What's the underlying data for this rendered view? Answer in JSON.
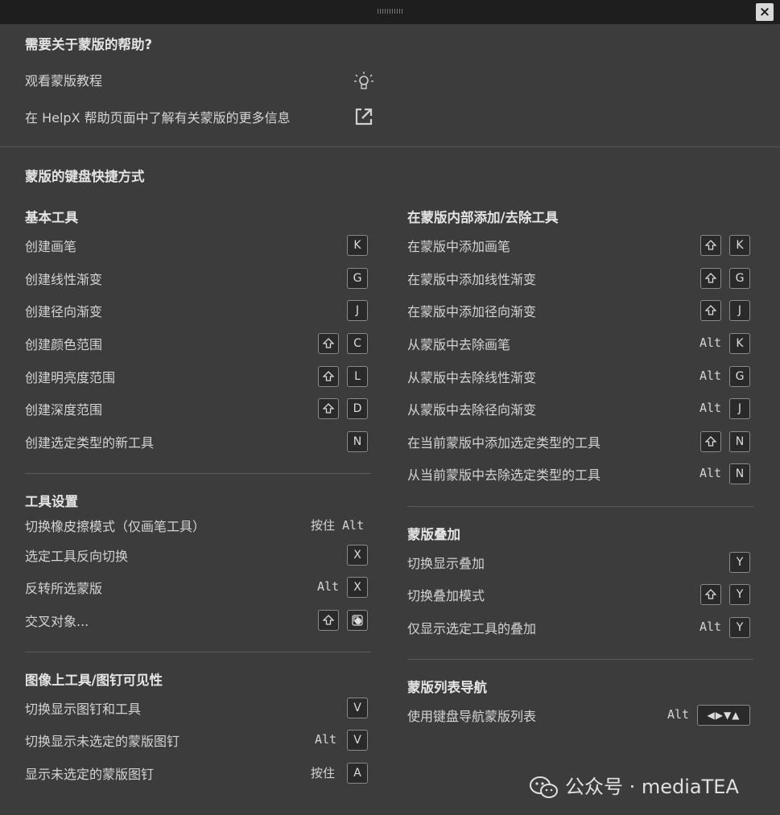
{
  "help": {
    "title": "需要关于蒙版的帮助?",
    "tutorial": "观看蒙版教程",
    "helpx": "在 HelpX 帮助页面中了解有关蒙版的更多信息"
  },
  "shortcuts_title": "蒙版的键盘快捷方式",
  "basic": {
    "title": "基本工具",
    "items": [
      {
        "label": "创建画笔",
        "key": "K"
      },
      {
        "label": "创建线性渐变",
        "key": "G"
      },
      {
        "label": "创建径向渐变",
        "key": "J"
      },
      {
        "label": "创建颜色范围",
        "key": "C"
      },
      {
        "label": "创建明亮度范围",
        "key": "L"
      },
      {
        "label": "创建深度范围",
        "key": "D"
      },
      {
        "label": "创建选定类型的新工具",
        "key": "N"
      }
    ]
  },
  "tool_settings": {
    "title": "工具设置",
    "items": [
      {
        "label": "切换橡皮擦模式（仅画笔工具）",
        "modifier": "按住 Alt"
      },
      {
        "label": "选定工具反向切换",
        "key": "X"
      },
      {
        "label": "反转所选蒙版",
        "modifier": "Alt",
        "key": "X"
      },
      {
        "label": "交叉对象..."
      }
    ]
  },
  "on_image": {
    "title": "图像上工具/图钉可见性",
    "items": [
      {
        "label": "切换显示图钉和工具",
        "key": "V"
      },
      {
        "label": "切换显示未选定的蒙版图钉",
        "modifier": "Alt",
        "key": "V"
      },
      {
        "label": "显示未选定的蒙版图钉",
        "modifier": "按住",
        "key": "A"
      }
    ]
  },
  "add_remove": {
    "title": "在蒙版内部添加/去除工具",
    "items": [
      {
        "label": "在蒙版中添加画笔",
        "key": "K"
      },
      {
        "label": "在蒙版中添加线性渐变",
        "key": "G"
      },
      {
        "label": "在蒙版中添加径向渐变",
        "key": "J"
      },
      {
        "label": "从蒙版中去除画笔",
        "modifier": "Alt",
        "key": "K"
      },
      {
        "label": "从蒙版中去除线性渐变",
        "modifier": "Alt",
        "key": "G"
      },
      {
        "label": "从蒙版中去除径向渐变",
        "modifier": "Alt",
        "key": "J"
      },
      {
        "label": "在当前蒙版中添加选定类型的工具",
        "key": "N"
      },
      {
        "label": "从当前蒙版中去除选定类型的工具",
        "modifier": "Alt",
        "key": "N"
      }
    ]
  },
  "overlay": {
    "title": "蒙版叠加",
    "items": [
      {
        "label": "切换显示叠加",
        "key": "Y"
      },
      {
        "label": "切换叠加模式",
        "key": "Y"
      },
      {
        "label": "仅显示选定工具的叠加",
        "modifier": "Alt",
        "key": "Y"
      }
    ]
  },
  "nav": {
    "title": "蒙版列表导航",
    "items": [
      {
        "label": "使用键盘导航蒙版列表",
        "modifier": "Alt",
        "key": "◀▶▼▲"
      }
    ]
  },
  "watermark": "公众号 · mediaTEA",
  "icons": {
    "close": "×",
    "tutorial": "lightbulb-icon",
    "helpx": "external-link-icon",
    "shift": "shift-icon",
    "intersect": "intersect-icon"
  }
}
